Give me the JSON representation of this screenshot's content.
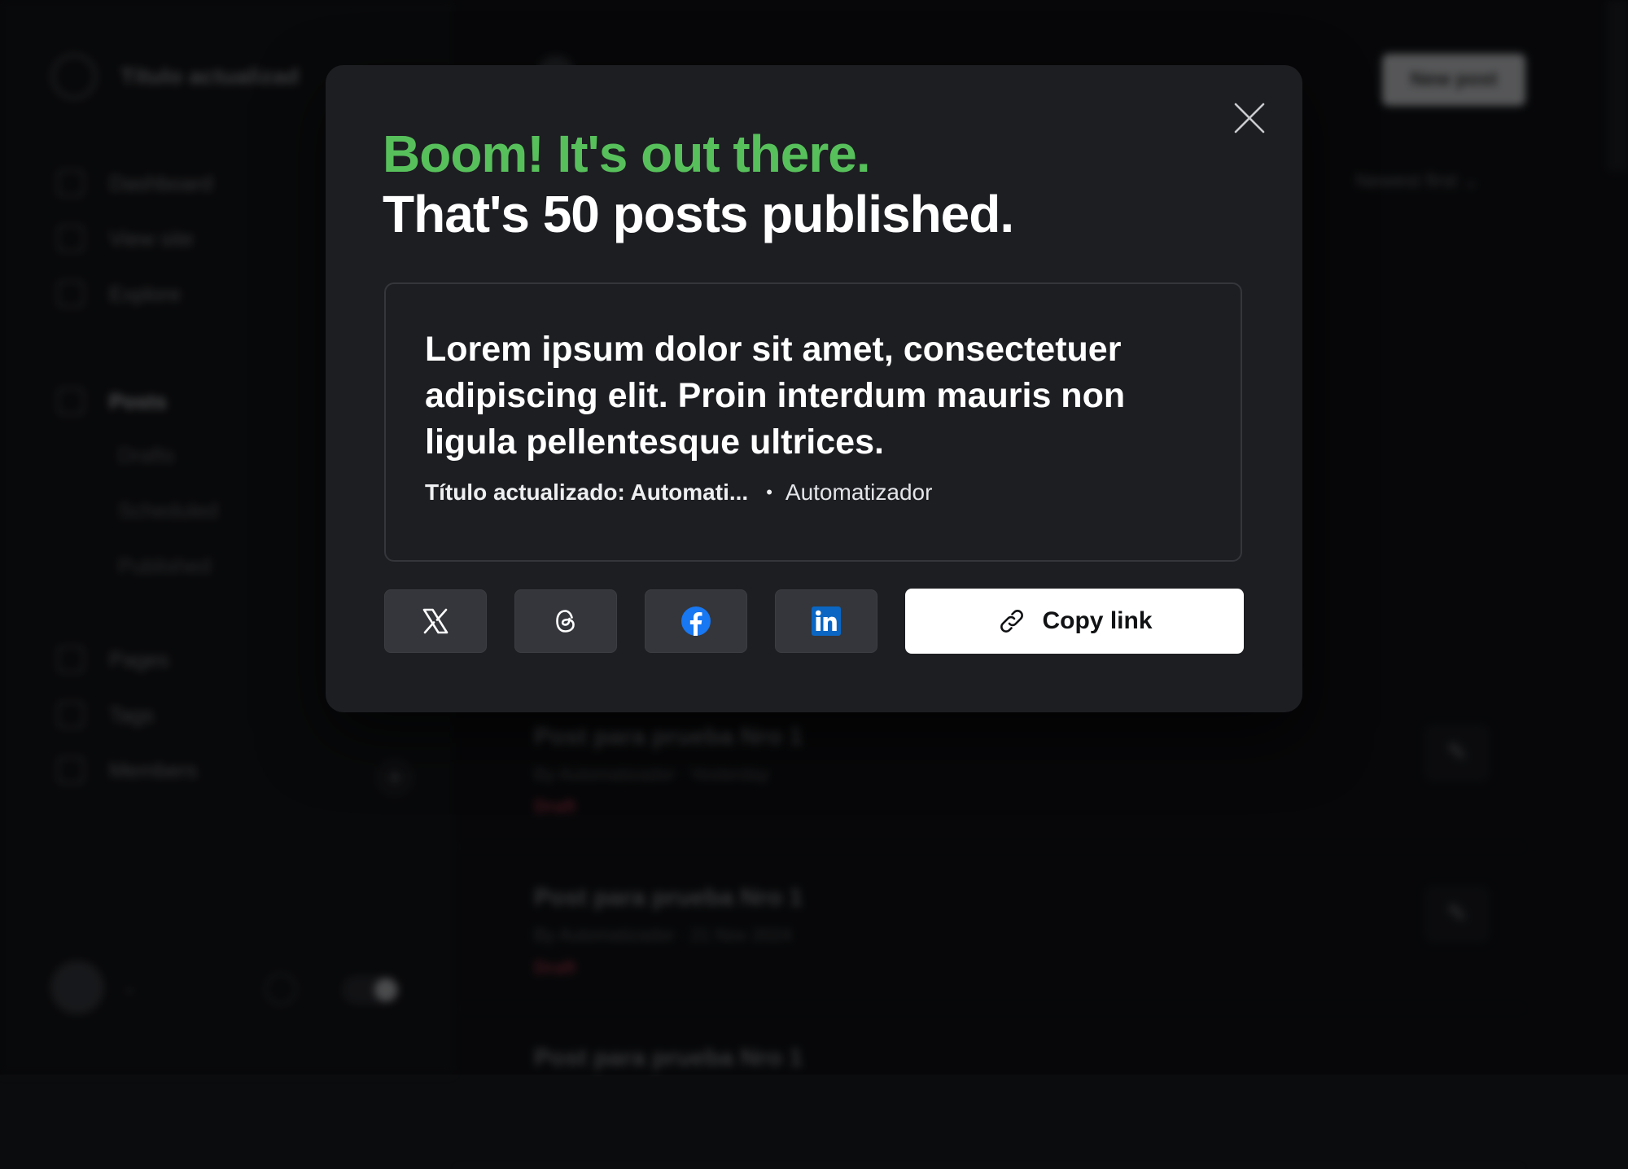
{
  "background": {
    "site_title": "Título actualizad",
    "nav": {
      "dashboard": "Dashboard",
      "view_site": "View site",
      "explore": "Explore",
      "posts": "Posts",
      "drafts": "Drafts",
      "scheduled": "Scheduled",
      "published": "Published",
      "pages": "Pages",
      "tags": "Tags",
      "members": "Members"
    },
    "new_post_label": "New post",
    "sort_label": "Newest first ⌄",
    "posts": [
      {
        "title": "Post para prueba Nro 1",
        "meta": "By Automatizador · Yesterday",
        "status": "Draft"
      },
      {
        "title": "Post para prueba Nro 1",
        "meta": "By Automatizador · 21 Nov 2024",
        "status": "Draft"
      },
      {
        "title": "Post para prueba Nro 1",
        "meta": "",
        "status": ""
      }
    ]
  },
  "modal": {
    "headline_highlight": "Boom! It's out there.",
    "headline_main": "That's 50 posts published.",
    "post_card": {
      "title": "Lorem ipsum dolor sit amet, consectetuer adipiscing elit. Proin interdum mauris non ligula pellentesque ultrices.",
      "post_meta_title": "Título actualizado: Automati...",
      "bullet": "•",
      "author": "Automatizador"
    },
    "share_buttons": [
      {
        "icon": "x-icon"
      },
      {
        "icon": "threads-icon"
      },
      {
        "icon": "facebook-icon"
      },
      {
        "icon": "linkedin-icon"
      }
    ],
    "copy_link_label": "Copy link",
    "copy_link_icon": "link-icon"
  },
  "colors": {
    "accent_green": "#57c05b",
    "modal_bg": "#1d1e22",
    "facebook_blue": "#1877f2",
    "linkedin_blue": "#0a66c2"
  }
}
